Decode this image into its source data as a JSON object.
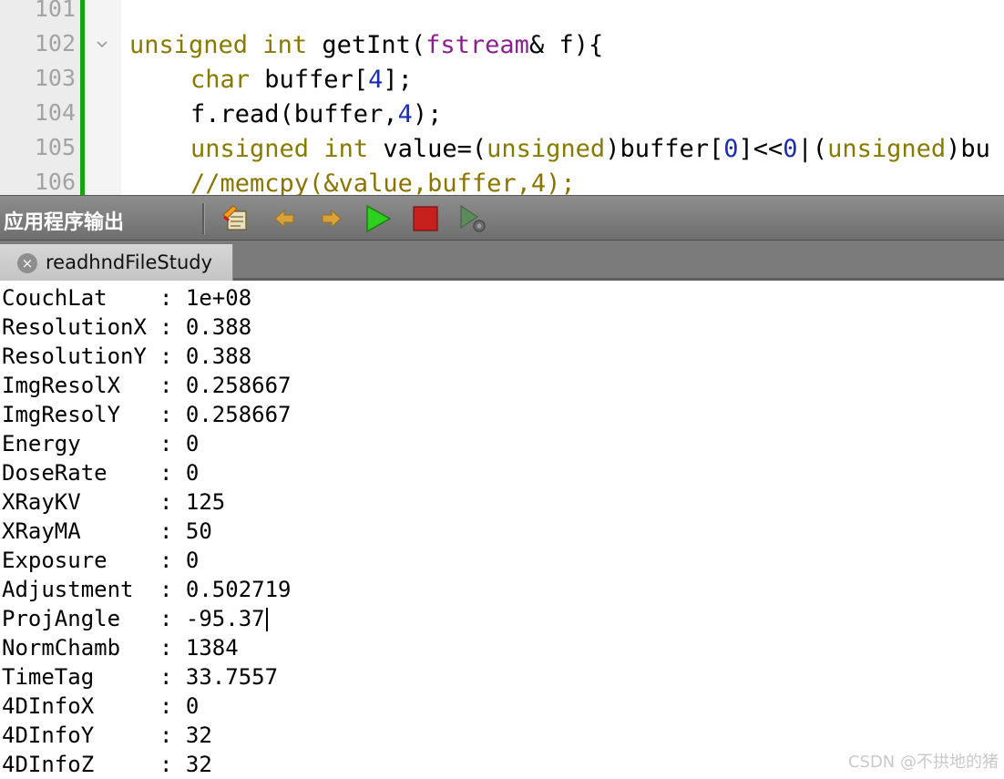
{
  "editor": {
    "line_numbers": [
      "101",
      "102",
      "103",
      "104",
      "105",
      "106"
    ],
    "lines": {
      "l102": {
        "kw1": "unsigned",
        "sp1": " ",
        "kw2": "int",
        "rest1": " getInt(",
        "id1": "fstream",
        "rest2": "& f){"
      },
      "l103": {
        "kw1": "char",
        "rest1": " buffer[",
        "num1": "4",
        "rest2": "];"
      },
      "l104": {
        "rest1": "f.read(buffer,",
        "num1": "4",
        "rest2": ");"
      },
      "l105": {
        "kw1": "unsigned",
        "sp1": " ",
        "kw2": "int",
        "rest1": " value=(",
        "kw3": "unsigned",
        "rest2": ")buffer[",
        "num1": "0",
        "rest3": "]<<",
        "num2": "0",
        "rest4": "|(",
        "kw4": "unsigned",
        "rest5": ")bu"
      },
      "l106": {
        "comment": "//memcpy(&value,buffer,4);"
      }
    }
  },
  "output_panel": {
    "title": "应用程序输出",
    "toolbar_icons": [
      "clear-output-icon",
      "previous-item-icon",
      "next-item-icon",
      "run-icon",
      "stop-icon",
      "attach-debugger-icon"
    ],
    "tab": {
      "label": "readhndFileStudy",
      "close_glyph": "×"
    }
  },
  "output": {
    "separator": ": ",
    "rows": [
      {
        "key": "CouchLat",
        "value": "1e+08"
      },
      {
        "key": "ResolutionX",
        "value": "0.388"
      },
      {
        "key": "ResolutionY",
        "value": "0.388"
      },
      {
        "key": "ImgResolX",
        "value": "0.258667"
      },
      {
        "key": "ImgResolY",
        "value": "0.258667"
      },
      {
        "key": "Energy",
        "value": "0"
      },
      {
        "key": "DoseRate",
        "value": "0"
      },
      {
        "key": "XRayKV",
        "value": "125"
      },
      {
        "key": "XRayMA",
        "value": "50"
      },
      {
        "key": "Exposure",
        "value": "0"
      },
      {
        "key": "Adjustment",
        "value": "0.502719"
      },
      {
        "key": "ProjAngle",
        "value": "-95.37"
      },
      {
        "key": "NormChamb",
        "value": "1384"
      },
      {
        "key": "TimeTag",
        "value": "33.7557"
      },
      {
        "key": "4DInfoX",
        "value": "0"
      },
      {
        "key": "4DInfoY",
        "value": "32"
      },
      {
        "key": "4DInfoZ",
        "value": "32"
      }
    ]
  },
  "watermark": "CSDN @不拱地的猪",
  "colors": {
    "gutter_bar": "#16a316",
    "keyword_type": "#877a00",
    "identifier": "#8a1f8f",
    "number": "#1a2fb0",
    "toolbar_bg": "#7b7b7b"
  }
}
